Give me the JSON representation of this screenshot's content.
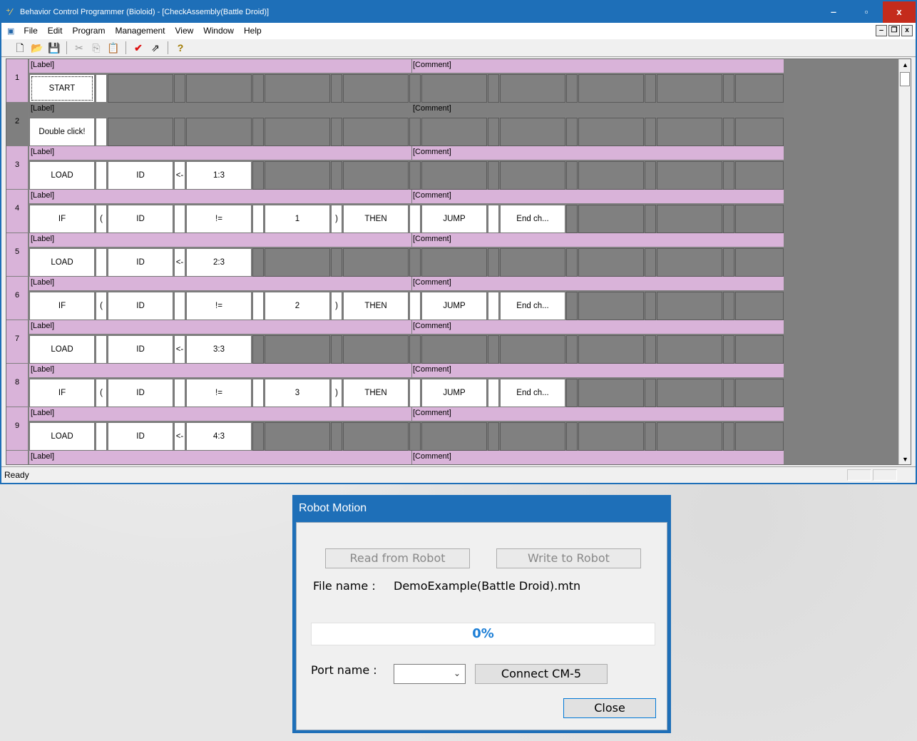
{
  "window": {
    "title": "Behavior Control Programmer (Bioloid) - [CheckAssembly(Battle Droid)]",
    "controls": {
      "minimize": "‒",
      "maximize": "▫",
      "close": "x"
    }
  },
  "menu": [
    "File",
    "Edit",
    "Program",
    "Management",
    "View",
    "Window",
    "Help"
  ],
  "mdi": {
    "minimize": "‒",
    "restore": "❐",
    "close": "x"
  },
  "toolbar": {
    "icons": [
      "new-file-icon",
      "open-folder-icon",
      "save-icon",
      "cut-icon",
      "copy-icon",
      "paste-icon",
      "check-icon",
      "compile-icon",
      "help-icon"
    ],
    "glyphs": {
      "new": "🗋",
      "open": "📂",
      "save": "💾",
      "cut": "✂",
      "copy": "⎘",
      "paste": "📋",
      "check": "✔",
      "compile": "⇗",
      "help": "?"
    }
  },
  "grid": {
    "label_text": "[Label]",
    "comment_text": "[Comment]",
    "rows": [
      {
        "num": "1",
        "cells": [
          "START"
        ]
      },
      {
        "num": "2",
        "cells": [
          "Double click!"
        ]
      },
      {
        "num": "3",
        "cells": [
          "LOAD",
          "",
          "ID",
          "<-",
          "1:3"
        ]
      },
      {
        "num": "4",
        "cells": [
          "IF",
          "(",
          "ID",
          "",
          "!=",
          "",
          "1",
          ")",
          "THEN",
          "",
          "JUMP",
          "",
          "End ch..."
        ]
      },
      {
        "num": "5",
        "cells": [
          "LOAD",
          "",
          "ID",
          "<-",
          "2:3"
        ]
      },
      {
        "num": "6",
        "cells": [
          "IF",
          "(",
          "ID",
          "",
          "!=",
          "",
          "2",
          ")",
          "THEN",
          "",
          "JUMP",
          "",
          "End ch..."
        ]
      },
      {
        "num": "7",
        "cells": [
          "LOAD",
          "",
          "ID",
          "<-",
          "3:3"
        ]
      },
      {
        "num": "8",
        "cells": [
          "IF",
          "(",
          "ID",
          "",
          "!=",
          "",
          "3",
          ")",
          "THEN",
          "",
          "JUMP",
          "",
          "End ch..."
        ]
      },
      {
        "num": "9",
        "cells": [
          "LOAD",
          "",
          "ID",
          "<-",
          "4:3"
        ]
      },
      {
        "num": "",
        "cells": []
      }
    ]
  },
  "status": {
    "text": "Ready"
  },
  "dialog": {
    "title": "Robot Motion",
    "read_button": "Read from Robot",
    "write_button": "Write to Robot",
    "file_label": "File name :",
    "file_value": "DemoExample(Battle Droid).mtn",
    "progress_value": 0,
    "progress_text": "0%",
    "port_label": "Port name :",
    "port_value": "",
    "connect_button": "Connect CM-5",
    "close_button": "Close",
    "colors": {
      "title_bar": "#1e6fb8",
      "progress_text": "#1c7ed6"
    }
  }
}
